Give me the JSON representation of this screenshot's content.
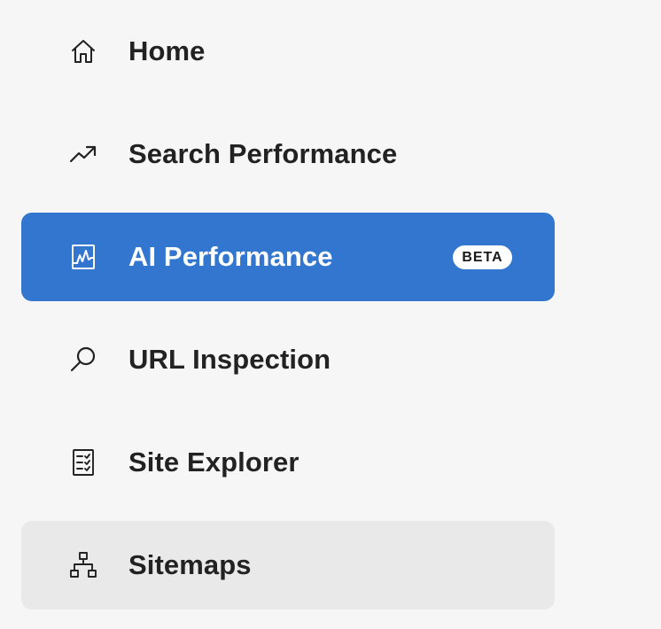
{
  "nav": {
    "items": [
      {
        "label": "Home",
        "icon": "home-icon"
      },
      {
        "label": "Search Performance",
        "icon": "trending-up-icon"
      },
      {
        "label": "AI Performance",
        "icon": "chart-frame-icon",
        "badge": "BETA",
        "selected": true
      },
      {
        "label": "URL Inspection",
        "icon": "magnifier-icon"
      },
      {
        "label": "Site Explorer",
        "icon": "checklist-icon"
      },
      {
        "label": "Sitemaps",
        "icon": "sitemap-icon",
        "hovered": true
      }
    ]
  },
  "colors": {
    "background": "#f6f6f6",
    "selected": "#3276d0",
    "hovered": "#e9e9e9",
    "text": "#222222",
    "selected_text": "#ffffff",
    "badge_bg": "#ffffff"
  }
}
